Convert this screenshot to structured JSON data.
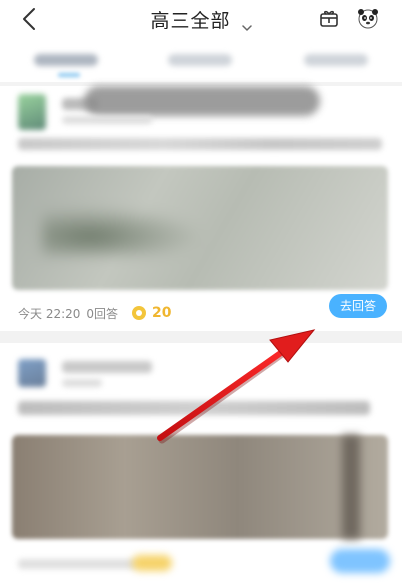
{
  "header": {
    "title": "高三全部",
    "icons": {
      "back": "back-icon",
      "chevron": "chevron-down-icon",
      "gift": "gift-icon",
      "avatar": "panda-avatar-icon"
    }
  },
  "cards": [
    {
      "time": "今天 22:20",
      "answers": "0回答",
      "reward": "20",
      "answer_button": "去回答"
    }
  ],
  "colors": {
    "accent": "#49b2ff",
    "coin": "#f3c53b",
    "arrow": "#e11d1d"
  }
}
